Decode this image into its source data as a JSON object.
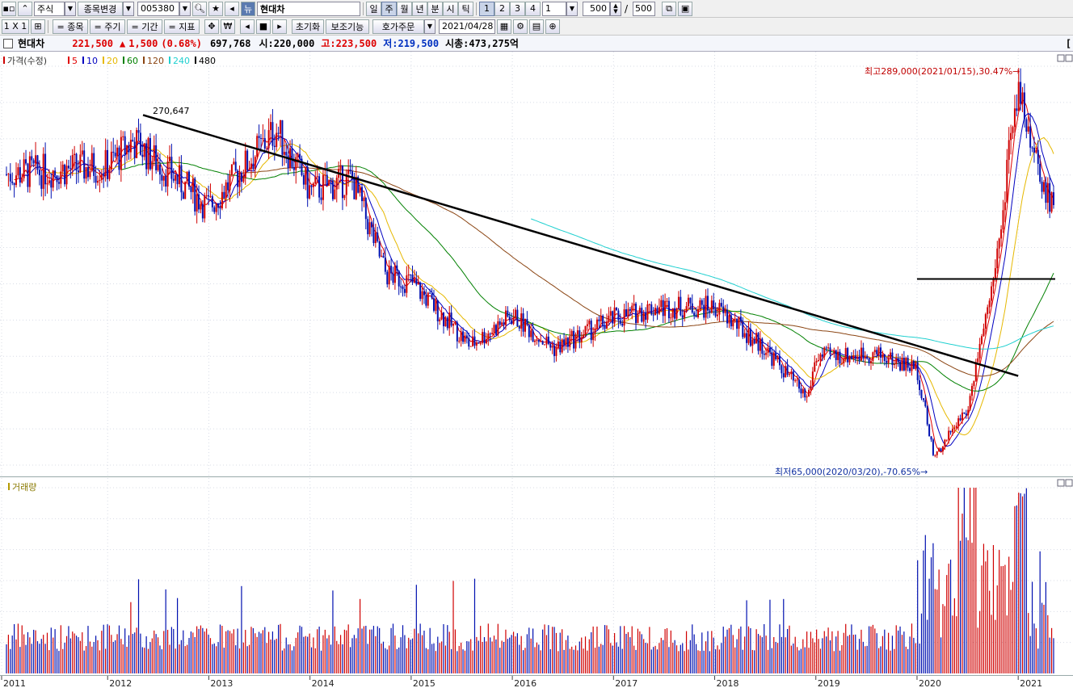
{
  "toolbar1": {
    "market": "주식",
    "change_label": "종목변경",
    "code": "005380",
    "name": "현대차",
    "periods": [
      "일",
      "주",
      "월",
      "년",
      "분",
      "시",
      "틱"
    ],
    "active_period": "주",
    "nums": [
      "1",
      "2",
      "3",
      "4"
    ],
    "active_num": "1",
    "num_value": "1",
    "count": "500",
    "total": "500"
  },
  "toolbar2": {
    "layout": "1 X 1",
    "buttons": [
      "= 종목",
      "= 주기",
      "= 기간",
      "= 지표"
    ],
    "reset": "초기화",
    "aux": "보조기능",
    "order": "호가주문",
    "date": "2021/04/28"
  },
  "quote": {
    "name": "현대차",
    "price": "221,500",
    "change_arrow": "▲",
    "change": "1,500",
    "change_pct": "(0.68%)",
    "volume": "697,768",
    "open_label": "시:",
    "open": "220,000",
    "high_label": "고:",
    "high": "223,500",
    "low_label": "저:",
    "low": "219,500",
    "cap_label": "시총:",
    "cap": "473,275억",
    "right_mark": "["
  },
  "price_panel": {
    "legend_title": "가격(수정)",
    "ma": [
      {
        "label": "5",
        "color": "#e00000"
      },
      {
        "label": "10",
        "color": "#0000c0"
      },
      {
        "label": "20",
        "color": "#e6b800"
      },
      {
        "label": "60",
        "color": "#008000"
      },
      {
        "label": "120",
        "color": "#8b4513"
      },
      {
        "label": "240",
        "color": "#20d0d0"
      },
      {
        "label": "480",
        "color": "#000000"
      }
    ],
    "trend_label": "270,647",
    "high_annotation": "최고289,000(2021/01/15),30.47%→",
    "low_annotation": "최저65,000(2020/03/20),-70.65%→"
  },
  "volume_panel": {
    "legend_title": "거래량"
  },
  "x_axis": [
    "2011",
    "2012",
    "2013",
    "2014",
    "2015",
    "2016",
    "2017",
    "2018",
    "2019",
    "2020",
    "2021"
  ],
  "chart_data": {
    "type": "candlestick",
    "period": "weekly",
    "title": "현대차",
    "x": [
      "2011",
      "2012",
      "2013",
      "2014",
      "2015",
      "2016",
      "2017",
      "2018",
      "2019",
      "2020",
      "2021"
    ],
    "price_series": [
      {
        "date": "2011",
        "close": 235000
      },
      {
        "date": "2012",
        "close": 240000
      },
      {
        "date": "2012-04",
        "close": 255000
      },
      {
        "date": "2013",
        "close": 215000
      },
      {
        "date": "2013-09",
        "close": 262000
      },
      {
        "date": "2014",
        "close": 225000
      },
      {
        "date": "2014-06",
        "close": 232000
      },
      {
        "date": "2014-10",
        "close": 175000
      },
      {
        "date": "2015",
        "close": 170000
      },
      {
        "date": "2015-08",
        "close": 132000
      },
      {
        "date": "2016",
        "close": 150000
      },
      {
        "date": "2016-06",
        "close": 130000
      },
      {
        "date": "2017",
        "close": 148000
      },
      {
        "date": "2017-06",
        "close": 155000
      },
      {
        "date": "2018",
        "close": 155000
      },
      {
        "date": "2018-07",
        "close": 130000
      },
      {
        "date": "2018-12",
        "close": 100000
      },
      {
        "date": "2019",
        "close": 125000
      },
      {
        "date": "2019-08",
        "close": 127000
      },
      {
        "date": "2020",
        "close": 118000
      },
      {
        "date": "2020-03",
        "close": 65000
      },
      {
        "date": "2020-07",
        "close": 95000
      },
      {
        "date": "2020-10",
        "close": 170000
      },
      {
        "date": "2021-01",
        "close": 289000
      },
      {
        "date": "2021-04",
        "close": 221500
      }
    ],
    "annotations": {
      "high": {
        "value": 289000,
        "date": "2021/01/15",
        "pct": 30.47
      },
      "low": {
        "value": 65000,
        "date": "2020/03/20",
        "pct": -70.65
      },
      "trendline_start": 270647
    },
    "moving_averages": [
      "5",
      "10",
      "20",
      "60",
      "120",
      "240",
      "480"
    ],
    "volume_series": "weekly volume bars, peak around 2021-01"
  }
}
